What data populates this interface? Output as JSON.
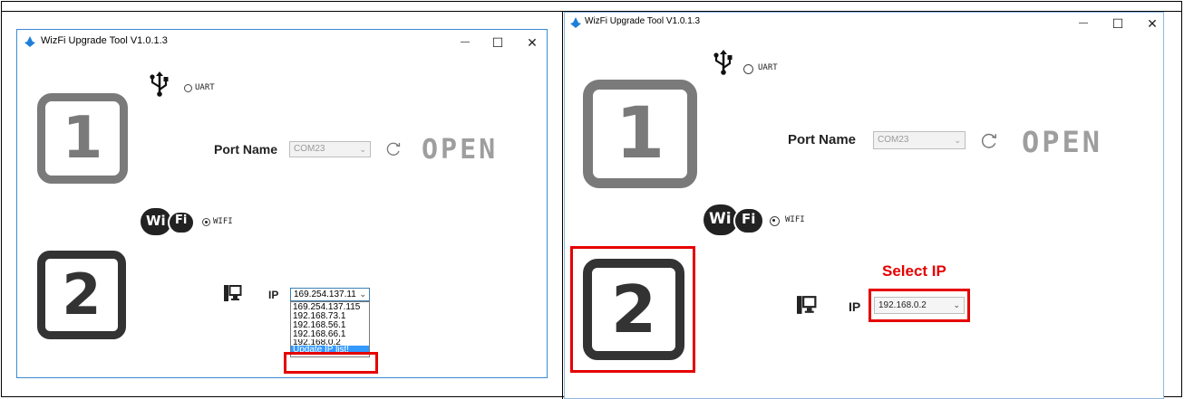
{
  "left": {
    "title": "WizFi Upgrade Tool V1.0.1.3",
    "controls": {
      "minimize": "—",
      "maximize": "☐",
      "close": "✕"
    },
    "uart_label": "UART",
    "step1": "1",
    "port_name_label": "Port Name",
    "port_value": "COM23",
    "open_label": "OPEN",
    "wifi_label": "WIFI",
    "wifi_logo_left": "Wi",
    "wifi_logo_right": "Fi",
    "step2": "2",
    "ip_label": "IP",
    "ip_selected": "169.254.137.11",
    "ip_options": [
      "169.254.137.115",
      "192.168.73.1",
      "192.168.56.1",
      "192.168.66.1",
      "192.168.0.2",
      "Update IP list!"
    ]
  },
  "right": {
    "title": "WizFi Upgrade Tool V1.0.1.3",
    "controls": {
      "minimize": "—",
      "maximize": "☐",
      "close": "✕"
    },
    "uart_label": "UART",
    "step1": "1",
    "port_name_label": "Port Name",
    "port_value": "COM23",
    "open_label": "OPEN",
    "wifi_label": "WIFI",
    "wifi_logo_left": "Wi",
    "wifi_logo_right": "Fi",
    "step2": "2",
    "ip_label": "IP",
    "ip_selected": "192.168.0.2",
    "select_ip_annotation": "Select IP"
  },
  "colors": {
    "window_border": "#3b8bd6",
    "highlight": "#e60000",
    "selection": "#3399ff",
    "step1_gray": "#7a7a7a"
  },
  "icons": [
    "app-icon",
    "usb-icon",
    "refresh-icon",
    "wifi-logo",
    "computer-icon",
    "chevron-down-icon"
  ]
}
